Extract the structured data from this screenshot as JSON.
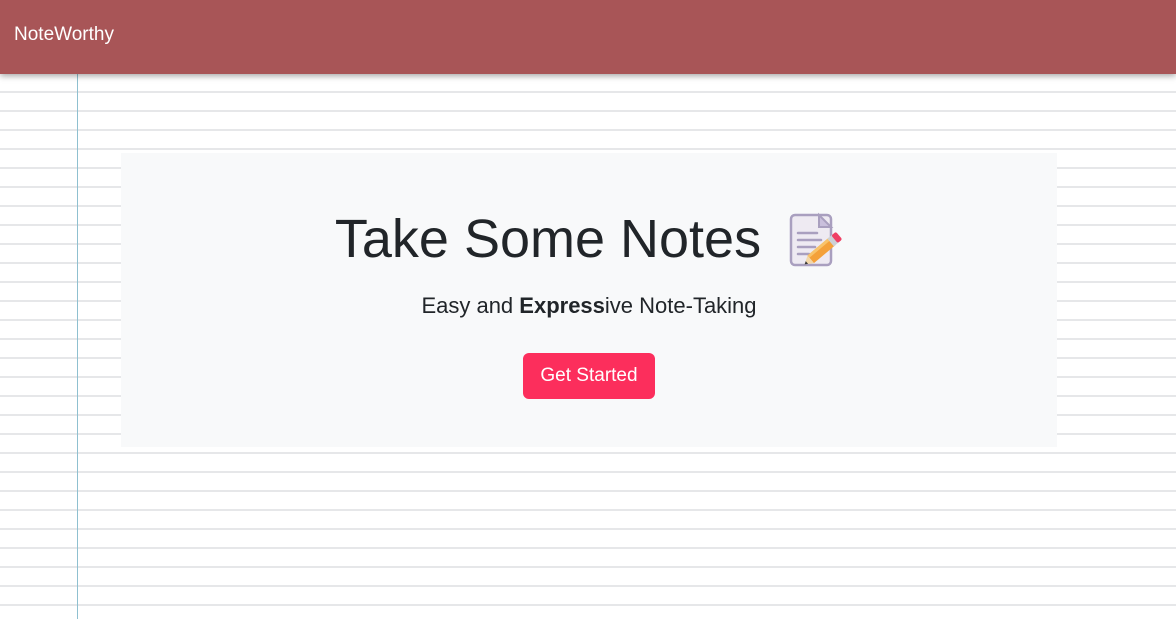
{
  "navbar": {
    "brand": "NoteWorthy"
  },
  "hero": {
    "title": "Take Some Notes",
    "title_icon": "memo-icon",
    "lead_prefix": "Easy and ",
    "lead_bold": "Express",
    "lead_suffix": "ive Note-Taking",
    "cta_label": "Get Started"
  },
  "colors": {
    "navbar": "#a85557",
    "cta": "#fc2e5c",
    "jumbotron": "#f8f9fa",
    "margin_line": "#8fc0d0",
    "ruled_line": "#e6e7e9"
  }
}
